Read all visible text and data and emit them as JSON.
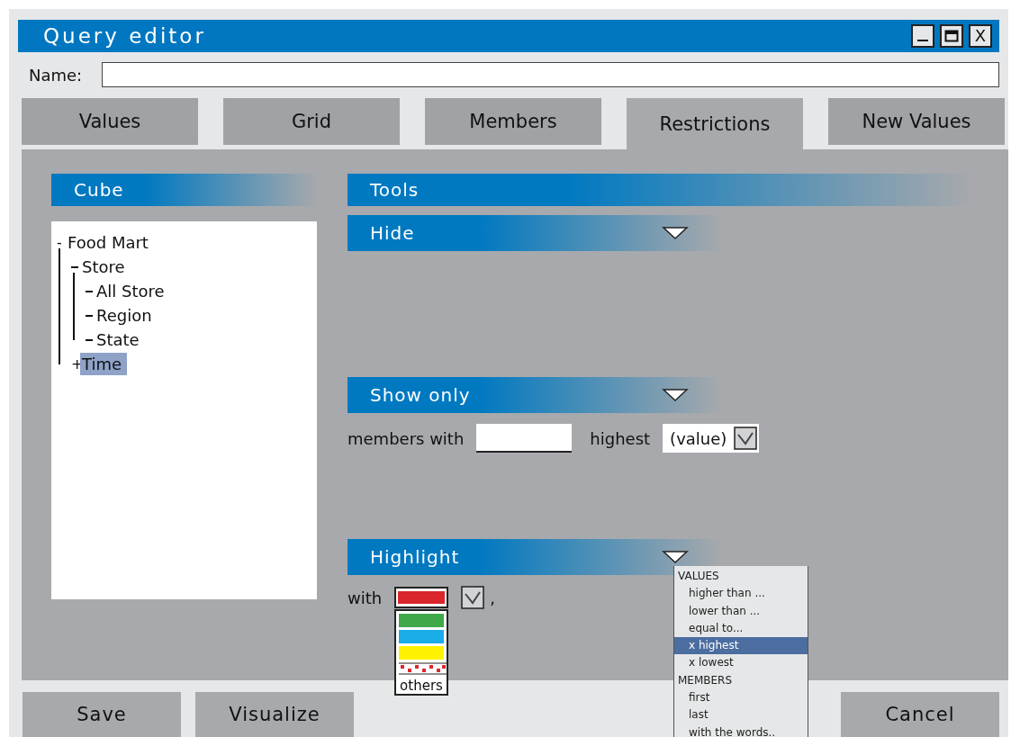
{
  "window": {
    "title": "Query editor",
    "controls": [
      {
        "kind": "minimize"
      },
      {
        "kind": "maximize"
      },
      {
        "kind": "close",
        "label": "X"
      }
    ]
  },
  "name_field": {
    "label": "Name:"
  },
  "tabs": [
    {
      "label": "Values",
      "selected": false
    },
    {
      "label": "Grid",
      "selected": false
    },
    {
      "label": "Members",
      "selected": false
    },
    {
      "label": "Restrictions",
      "selected": true
    },
    {
      "label": "New Values",
      "selected": false
    }
  ],
  "cube": {
    "title": "Cube",
    "tree": [
      {
        "label": "Food Mart",
        "toggle": "-",
        "selected": false,
        "children": [
          {
            "label": "Store",
            "selected": false,
            "children": [
              {
                "label": "All Store",
                "selected": false
              },
              {
                "label": "Region",
                "selected": false
              },
              {
                "label": "State",
                "selected": false
              }
            ]
          },
          {
            "label": "Time",
            "toggle": "+",
            "selected": true
          }
        ]
      }
    ]
  },
  "tools": {
    "title": "Tools",
    "sections": [
      {
        "kind": "hide",
        "title": "Hide"
      },
      {
        "kind": "show_only",
        "title": "Show only",
        "label": "members with",
        "label2": "highest",
        "select_value": "(value)"
      },
      {
        "kind": "highlight",
        "title": "Highlight",
        "label": "with",
        "suffix": ",",
        "colors": [
          {
            "kind": "swatch",
            "color": "#d9262c",
            "selected": true
          },
          {
            "kind": "swatch",
            "color": "#3fa94a",
            "selected": false
          },
          {
            "kind": "swatch",
            "color": "#1aace6",
            "selected": false
          },
          {
            "kind": "swatch",
            "color": "#fff200",
            "selected": false
          },
          {
            "kind": "pattern",
            "color": "#e0262c",
            "selected": false
          },
          {
            "kind": "others",
            "label": "others",
            "selected": false
          }
        ],
        "menu": [
          {
            "kind": "heading",
            "label": "VALUES",
            "selected": false
          },
          {
            "kind": "option",
            "label": "higher than ...",
            "selected": false
          },
          {
            "kind": "option",
            "label": "lower than ...",
            "selected": false
          },
          {
            "kind": "option",
            "label": "equal to...",
            "selected": false
          },
          {
            "kind": "option",
            "label": "x highest",
            "selected": true
          },
          {
            "kind": "option",
            "label": "x lowest",
            "selected": false
          },
          {
            "kind": "heading",
            "label": "MEMBERS",
            "selected": false
          },
          {
            "kind": "option",
            "label": "first",
            "selected": false
          },
          {
            "kind": "option",
            "label": "last",
            "selected": false
          },
          {
            "kind": "option",
            "label": "with the words..",
            "selected": false
          }
        ]
      }
    ]
  },
  "left_buttons": [
    {
      "label": "Save"
    },
    {
      "label": "Visualize"
    }
  ],
  "right_buttons": [
    {
      "label": "Cancel"
    }
  ]
}
